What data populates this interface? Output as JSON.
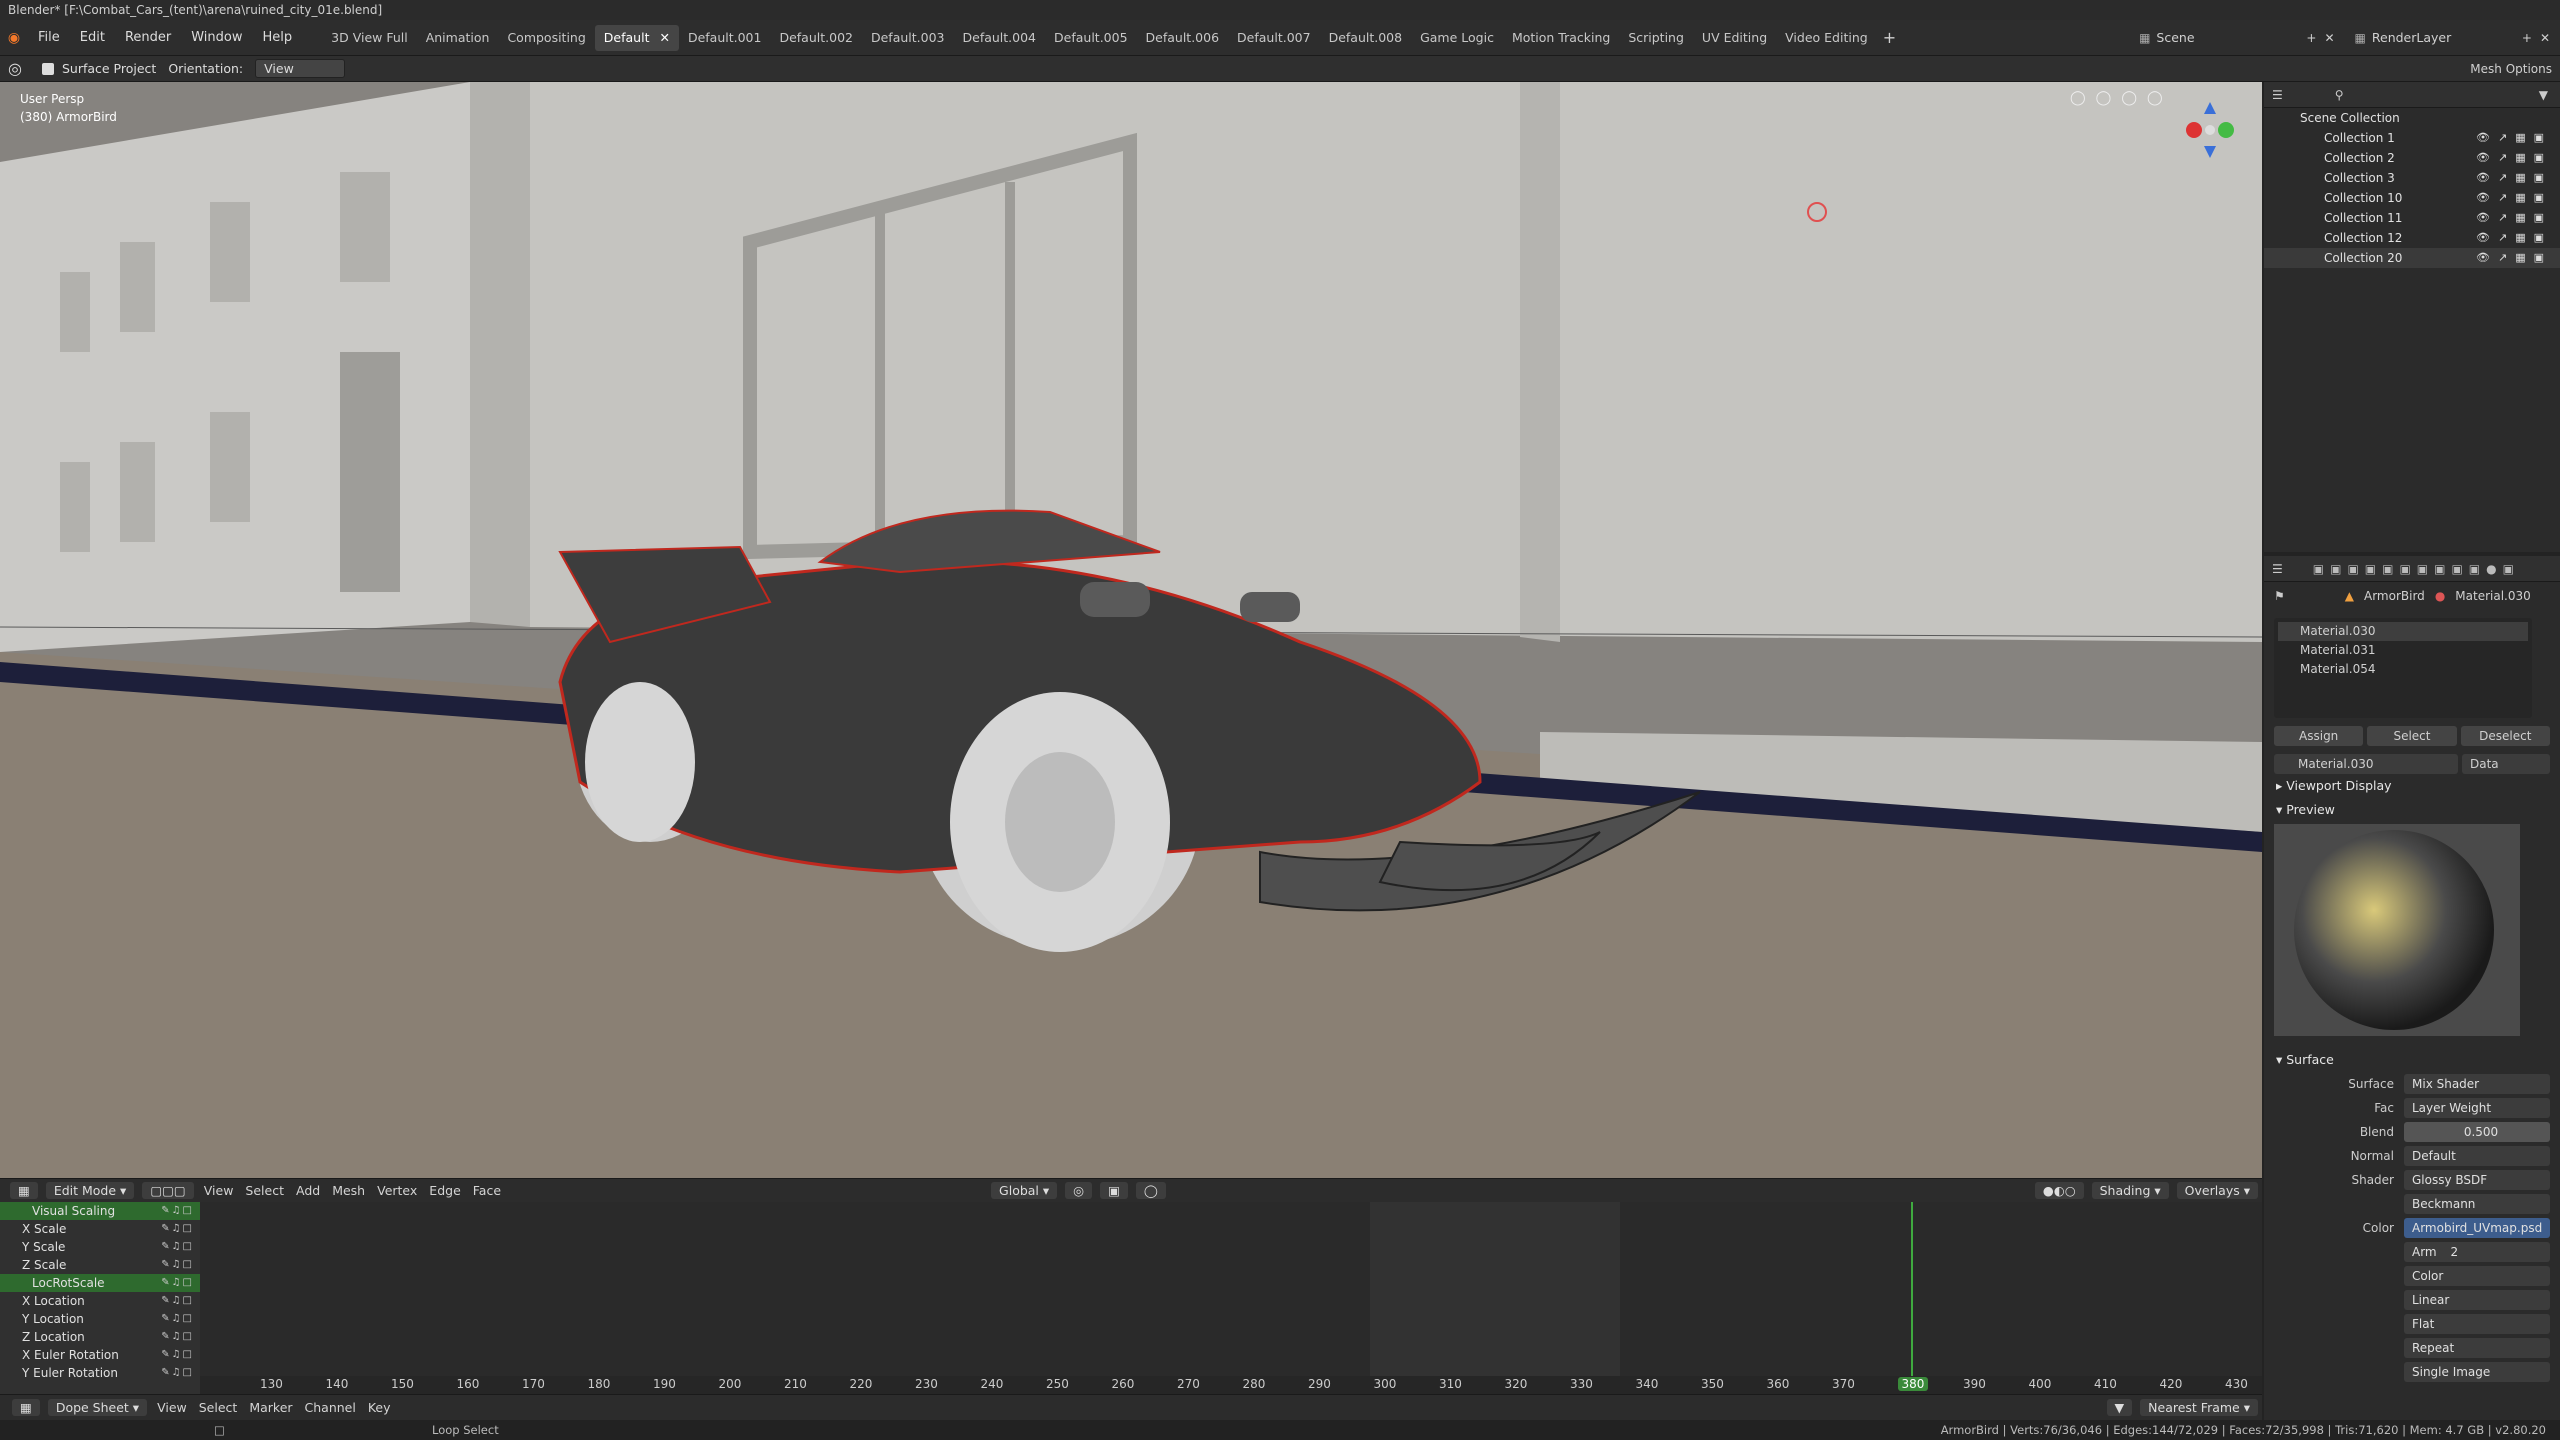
{
  "window": {
    "title": "Blender* [F:\\Combat_Cars_(tent)\\arena\\ruined_city_01e.blend]"
  },
  "menu": {
    "items": [
      "File",
      "Edit",
      "Render",
      "Window",
      "Help"
    ]
  },
  "workspaces": [
    "3D View Full",
    "Animation",
    "Compositing",
    "Default",
    "Default.001",
    "Default.002",
    "Default.003",
    "Default.004",
    "Default.005",
    "Default.006",
    "Default.007",
    "Default.008",
    "Game Logic",
    "Motion Tracking",
    "Scripting",
    "UV Editing",
    "Video Editing"
  ],
  "active_workspace": "Default",
  "scene": {
    "name": "Scene",
    "render_layer": "RenderLayer"
  },
  "tool_header": {
    "surface_project": "Surface Project",
    "orientation_label": "Orientation:",
    "orientation_value": "View",
    "mesh_options": "Mesh Options"
  },
  "viewport": {
    "perspective": "User Persp",
    "object": "(380) ArmorBird"
  },
  "viewport_toolbar": {
    "mode": "Edit Mode",
    "menus": [
      "View",
      "Select",
      "Add",
      "Mesh",
      "Vertex",
      "Edge",
      "Face"
    ],
    "transform": "Global",
    "shading": "Shading",
    "overlays": "Overlays"
  },
  "dopesheet": {
    "channels": [
      {
        "name": "Visual Scaling",
        "group": true
      },
      {
        "name": "X Scale",
        "group": false
      },
      {
        "name": "Y Scale",
        "group": false
      },
      {
        "name": "Z Scale",
        "group": false
      },
      {
        "name": "LocRotScale",
        "group": true
      },
      {
        "name": "X Location",
        "group": false
      },
      {
        "name": "Y Location",
        "group": false
      },
      {
        "name": "Z Location",
        "group": false
      },
      {
        "name": "X Euler Rotation",
        "group": false
      },
      {
        "name": "Y Euler Rotation",
        "group": false
      }
    ],
    "frames": [
      "130",
      "140",
      "150",
      "160",
      "170",
      "180",
      "190",
      "200",
      "210",
      "220",
      "230",
      "240",
      "250",
      "260",
      "270",
      "280",
      "290",
      "300",
      "310",
      "320",
      "330",
      "340",
      "350",
      "360",
      "370",
      "380",
      "390",
      "400",
      "410",
      "420",
      "430"
    ],
    "current_frame": "380",
    "footer": {
      "editor": "Dope Sheet",
      "menus": [
        "View",
        "Select",
        "Marker",
        "Channel",
        "Key"
      ],
      "snap": "Nearest Frame"
    }
  },
  "outliner": {
    "root": "Scene Collection",
    "collections": [
      "Collection 1",
      "Collection 2",
      "Collection 3",
      "Collection 10",
      "Collection 11",
      "Collection 12",
      "Collection 20"
    ]
  },
  "properties": {
    "object": "ArmorBird",
    "material": "Material.030",
    "slots": [
      "Material.030",
      "Material.031",
      "Material.054"
    ],
    "buttons": [
      "Assign",
      "Select",
      "Deselect"
    ],
    "material_field": "Material.030",
    "link": "Data",
    "panels": [
      "Viewport Display",
      "Preview",
      "Surface"
    ],
    "surface": [
      {
        "label": "Surface",
        "value": "Mix Shader"
      },
      {
        "label": "Fac",
        "value": "Layer Weight"
      },
      {
        "label": "Blend",
        "value": "0.500"
      },
      {
        "label": "Normal",
        "value": "Default"
      },
      {
        "label": "Shader",
        "value": "Glossy BSDF"
      },
      {
        "label": "",
        "value": "Beckmann"
      },
      {
        "label": "Color",
        "value": "Armobird_UVmap.psd"
      }
    ],
    "image_name": "Arm",
    "image_users": "2",
    "image_options": [
      "Color",
      "Linear",
      "Flat",
      "Repeat",
      "Single Image"
    ]
  },
  "status": {
    "hint": "Loop Select",
    "stats": "ArmorBird | Verts:76/36,046 | Edges:144/72,029 | Faces:72/35,998 | Tris:71,620 | Mem: 4.7 GB | v2.80.20"
  },
  "colors": {
    "accent": "#4a7a2a",
    "keyframe_line": "#3faa3f",
    "selection": "#e07020"
  }
}
